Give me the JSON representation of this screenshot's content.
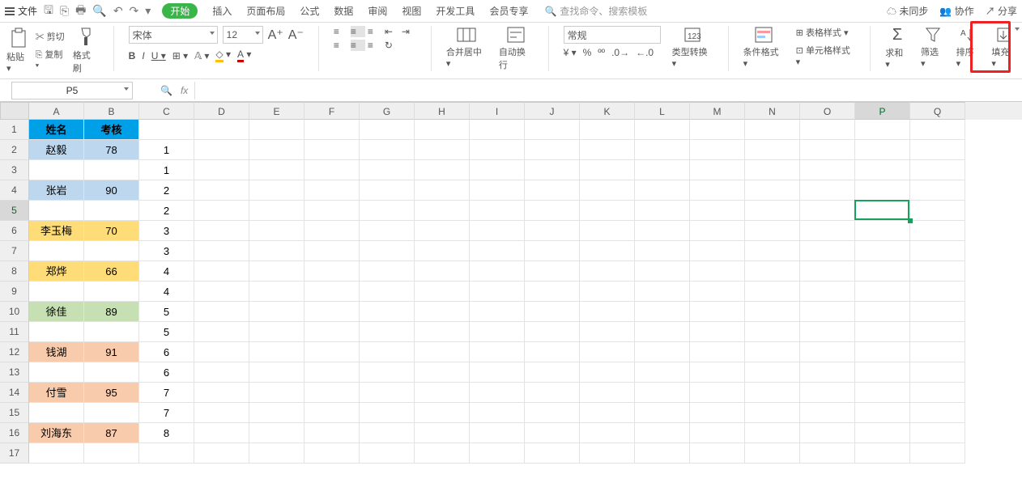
{
  "top": {
    "file": "文件",
    "redo_dd": "▾",
    "start": "开始",
    "tabs": [
      "插入",
      "页面布局",
      "公式",
      "数据",
      "审阅",
      "视图",
      "开发工具",
      "会员专享"
    ],
    "search_placeholder": "查找命令、搜索模板",
    "unsynced": "未同步",
    "collab": "协作",
    "share": "分享"
  },
  "ribbon": {
    "paste": "粘贴",
    "cut": "剪切",
    "copy": "复制",
    "format_paint": "格式刷",
    "font_name": "宋体",
    "font_size": "12",
    "bold": "B",
    "italic": "I",
    "underline": "U",
    "merge_center": "合并居中",
    "auto_wrap": "自动换行",
    "num_format": "常规",
    "type_convert": "类型转换",
    "cond_format": "条件格式",
    "table_style": "表格样式",
    "cell_style": "单元格样式",
    "sum": "求和",
    "filter": "筛选",
    "sort": "排序",
    "fill": "填充"
  },
  "namebox": "P5",
  "fx": "fx",
  "columns": [
    "A",
    "B",
    "C",
    "D",
    "E",
    "F",
    "G",
    "H",
    "I",
    "J",
    "K",
    "L",
    "M",
    "N",
    "O",
    "P",
    "Q"
  ],
  "rows": [
    {
      "n": 1,
      "a": "姓名",
      "b": "考核",
      "c": "",
      "a_cls": "hdr-name",
      "b_cls": "hdr-score"
    },
    {
      "n": 2,
      "a": "赵毅",
      "b": "78",
      "c": "1",
      "a_cls": "blue-lt",
      "b_cls": "blue-lt"
    },
    {
      "n": 3,
      "a": "",
      "b": "",
      "c": "1"
    },
    {
      "n": 4,
      "a": "张岩",
      "b": "90",
      "c": "2",
      "a_cls": "blue-lt",
      "b_cls": "blue-lt"
    },
    {
      "n": 5,
      "a": "",
      "b": "",
      "c": "2"
    },
    {
      "n": 6,
      "a": "李玉梅",
      "b": "70",
      "c": "3",
      "a_cls": "yellow",
      "b_cls": "yellow"
    },
    {
      "n": 7,
      "a": "",
      "b": "",
      "c": "3"
    },
    {
      "n": 8,
      "a": "郑烨",
      "b": "66",
      "c": "4",
      "a_cls": "yellow",
      "b_cls": "yellow"
    },
    {
      "n": 9,
      "a": "",
      "b": "",
      "c": "4"
    },
    {
      "n": 10,
      "a": "徐佳",
      "b": "89",
      "c": "5",
      "a_cls": "green-lt",
      "b_cls": "green-lt"
    },
    {
      "n": 11,
      "a": "",
      "b": "",
      "c": "5"
    },
    {
      "n": 12,
      "a": "钱湖",
      "b": "91",
      "c": "6",
      "a_cls": "orange-lt",
      "b_cls": "orange-lt"
    },
    {
      "n": 13,
      "a": "",
      "b": "",
      "c": "6"
    },
    {
      "n": 14,
      "a": "付雪",
      "b": "95",
      "c": "7",
      "a_cls": "orange-lt",
      "b_cls": "orange-lt"
    },
    {
      "n": 15,
      "a": "",
      "b": "",
      "c": "7"
    },
    {
      "n": 16,
      "a": "刘海东",
      "b": "87",
      "c": "8",
      "a_cls": "orange-lt",
      "b_cls": "orange-lt"
    },
    {
      "n": 17,
      "a": "",
      "b": "",
      "c": ""
    }
  ],
  "sel": {
    "col": "P",
    "row": 5
  }
}
